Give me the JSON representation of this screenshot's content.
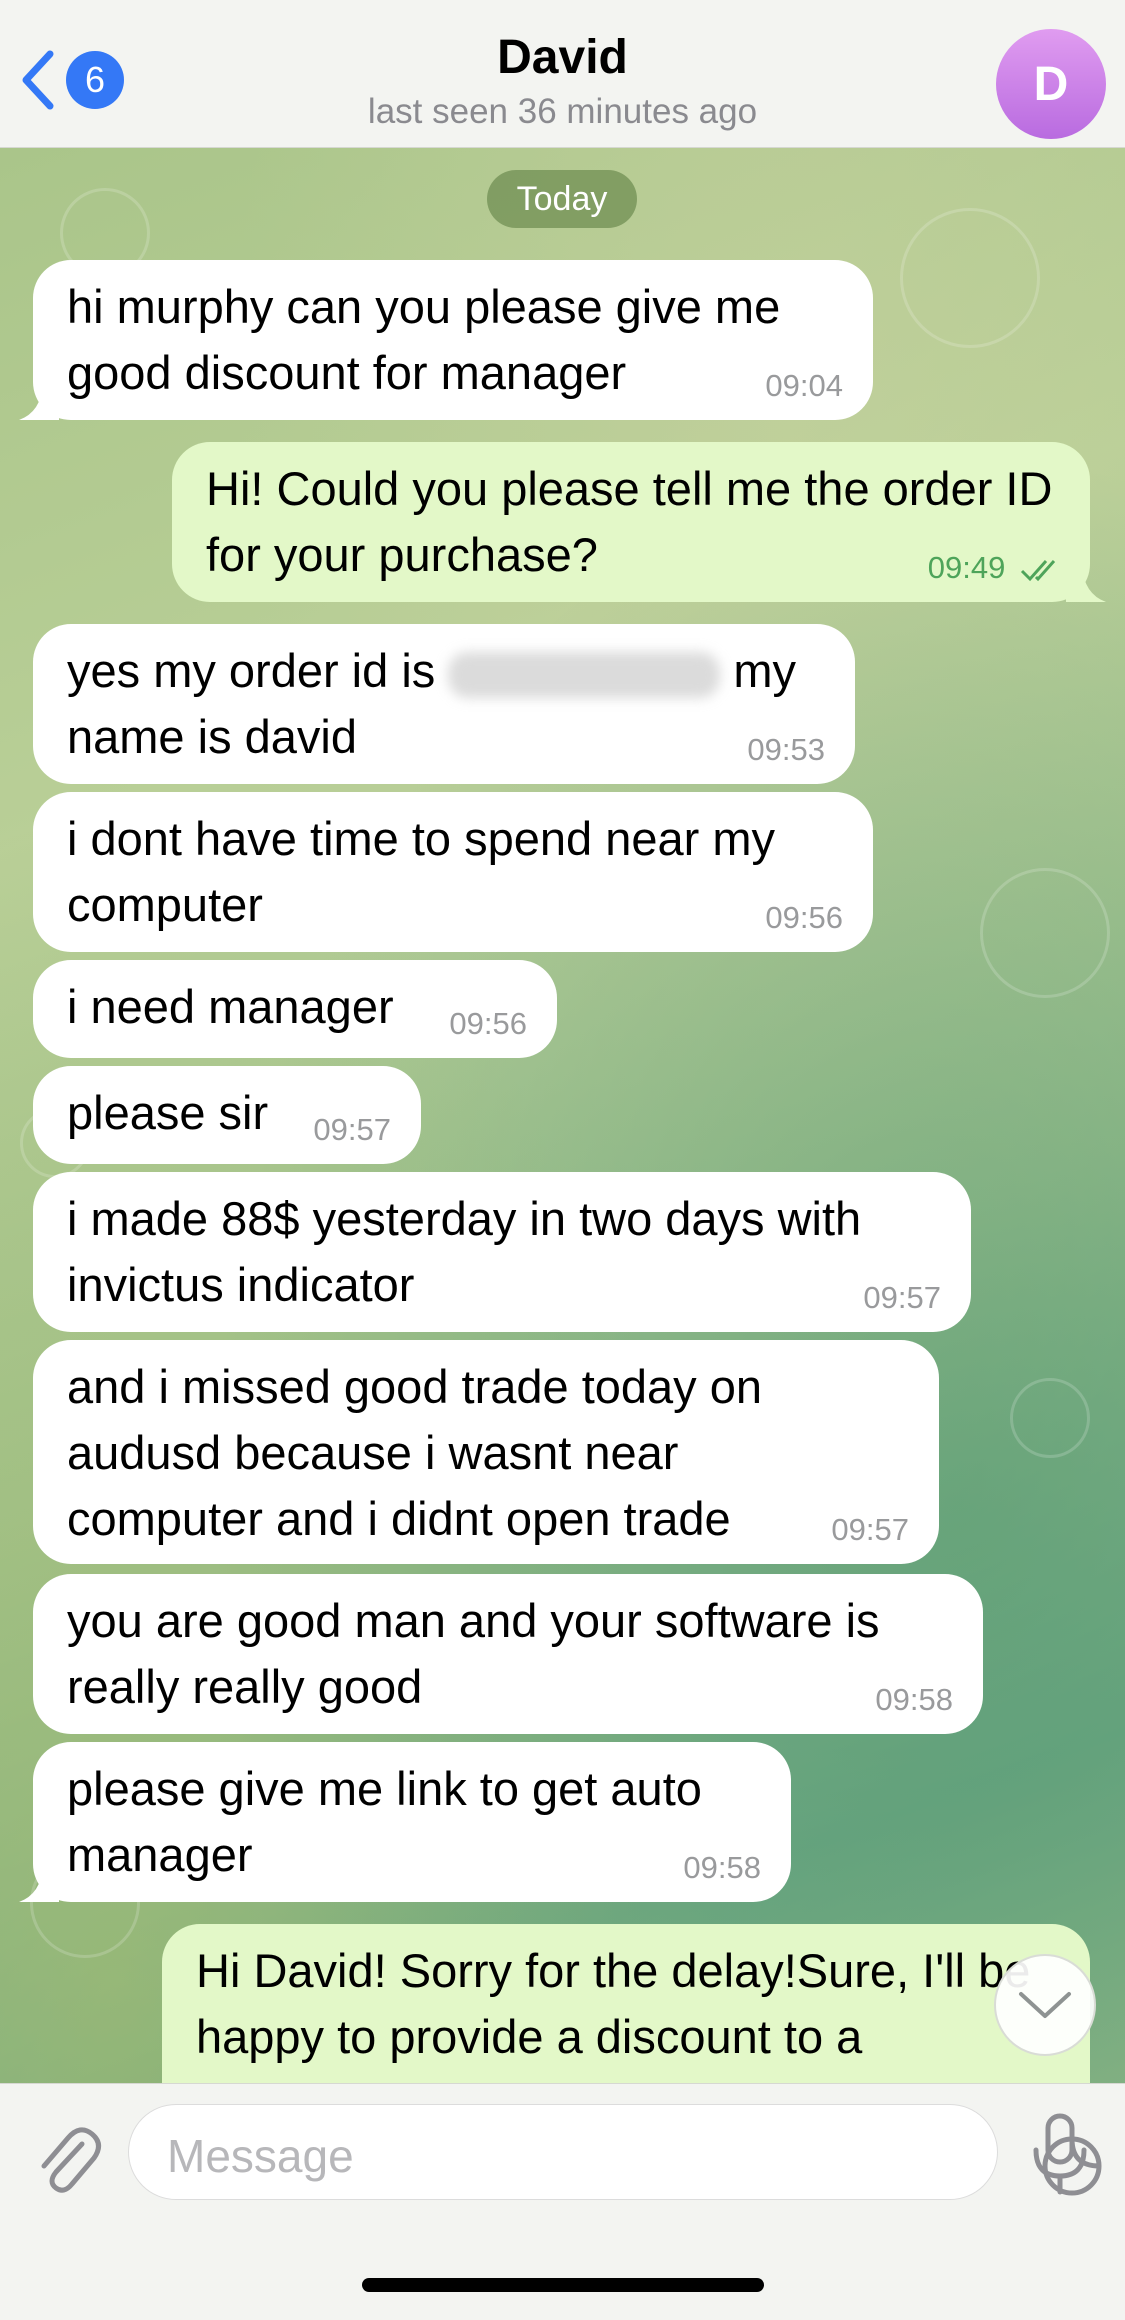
{
  "header": {
    "back_count": "6",
    "title": "David",
    "subtitle": "last seen 36 minutes ago",
    "avatar_letter": "D"
  },
  "date_separator": "Today",
  "messages": [
    {
      "dir": "in",
      "text": "hi murphy can you please give me good discount for manager",
      "time": "09:04"
    },
    {
      "dir": "out",
      "text": "Hi! Could you please tell me the order ID for your purchase?",
      "time": "09:49"
    },
    {
      "dir": "in",
      "text_before": "yes my order id is",
      "text_after": "my name is david",
      "time": "09:53"
    },
    {
      "dir": "in",
      "text": "i dont have time to spend near my computer",
      "time": "09:56"
    },
    {
      "dir": "in",
      "text": "i need manager",
      "time": "09:56"
    },
    {
      "dir": "in",
      "text": "please sir",
      "time": "09:57"
    },
    {
      "dir": "in",
      "text": "i made 88$ yesterday in two days with invictus indicator",
      "time": "09:57"
    },
    {
      "dir": "in",
      "text": "and i missed good trade today on audusd because i wasnt near computer and i didnt open trade",
      "time": "09:57"
    },
    {
      "dir": "in",
      "text": "you are good man and your software is really really good",
      "time": "09:58"
    },
    {
      "dir": "in",
      "text": "please give me link to get auto manager",
      "time": "09:58"
    },
    {
      "dir": "out",
      "text": "Hi David! Sorry for the delay!Sure, I'll be happy to provide a discount to a",
      "time": ""
    }
  ],
  "input": {
    "placeholder": "Message"
  },
  "colors": {
    "accent": "#3478f6",
    "incoming_bubble": "#ffffff",
    "outgoing_bubble": "#e3f8c8",
    "read_ticks": "#4ea45a"
  },
  "icons": [
    "chevron-left-icon",
    "paperclip-icon",
    "sticker-icon",
    "microphone-icon",
    "chevron-down-icon",
    "double-check-icon"
  ]
}
